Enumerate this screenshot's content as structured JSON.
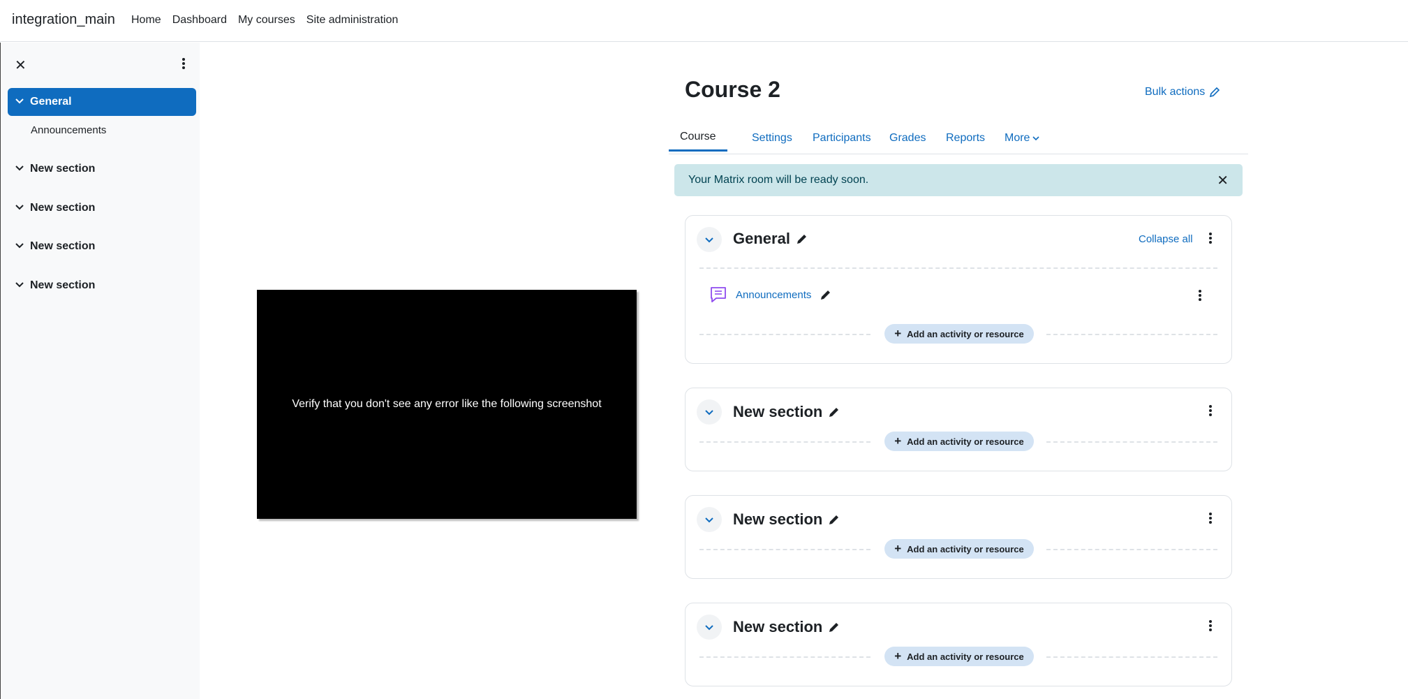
{
  "navbar": {
    "brand": "integration_main",
    "links": [
      "Home",
      "Dashboard",
      "My courses",
      "Site administration"
    ]
  },
  "drawer": {
    "items": [
      {
        "label": "General"
      },
      {
        "label": "Announcements"
      },
      {
        "label": "New section"
      },
      {
        "label": "New section"
      },
      {
        "label": "New section"
      },
      {
        "label": "New section"
      }
    ]
  },
  "video": {
    "caption": "Verify that you don't see any error like the following screenshot"
  },
  "course": {
    "title": "Course 2",
    "bulk_actions": "Bulk actions",
    "tabs": [
      "Course",
      "Settings",
      "Participants",
      "Grades",
      "Reports",
      "More"
    ],
    "alert": "Your Matrix room will be ready soon.",
    "collapse_all": "Collapse all",
    "add_activity": "Add an activity or resource",
    "sections": [
      {
        "title": "General",
        "activities": [
          "Announcements"
        ]
      },
      {
        "title": "New section"
      },
      {
        "title": "New section"
      },
      {
        "title": "New section"
      }
    ]
  },
  "colors": {
    "primary": "#0f6cbf",
    "alert_bg": "#cce6ea",
    "add_btn_bg": "#d3e3f4",
    "activity_icon": "#8f4bef"
  }
}
